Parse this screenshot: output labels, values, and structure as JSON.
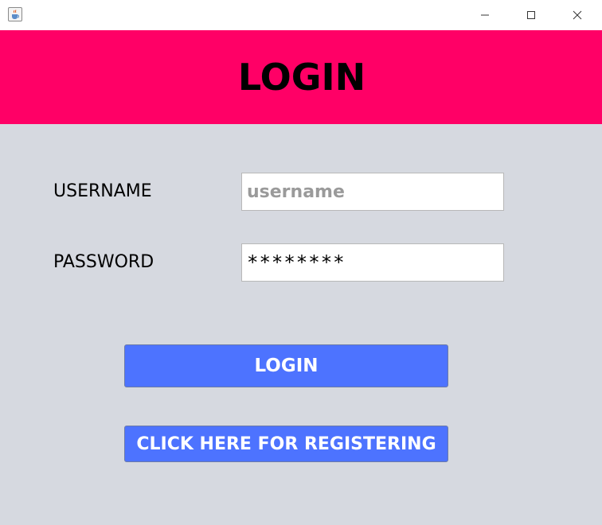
{
  "window": {
    "app_icon": "java-cup-icon",
    "controls": [
      "minimize-icon",
      "maximize-icon",
      "close-icon"
    ]
  },
  "header": {
    "title": "LOGIN",
    "background": "#ff0066"
  },
  "form": {
    "username_label": "USERNAME",
    "username_placeholder": "username",
    "username_value": "",
    "password_label": "PASSWORD",
    "password_value": "********",
    "background": "#d6d9e0"
  },
  "buttons": {
    "login_label": "LOGIN",
    "register_label": "CLICK HERE FOR REGISTERING",
    "accent": "#4d73ff"
  }
}
